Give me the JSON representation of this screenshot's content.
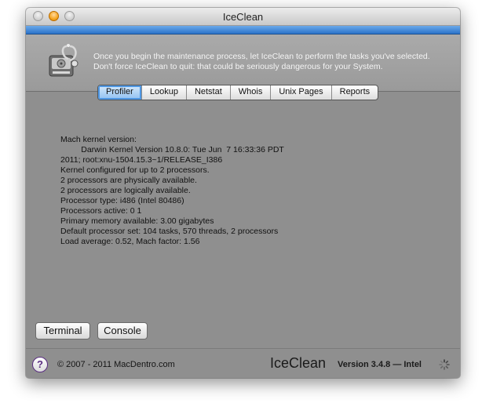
{
  "window": {
    "title": "IceClean"
  },
  "header": {
    "line1": "Once you begin the maintenance process, let IceClean to perform the tasks you've selected.",
    "line2": "Don't force IceClean to quit: that could be seriously dangerous for your System."
  },
  "tabs": [
    {
      "label": "Profiler",
      "active": true
    },
    {
      "label": "Lookup"
    },
    {
      "label": "Netstat"
    },
    {
      "label": "Whois"
    },
    {
      "label": "Unix Pages"
    },
    {
      "label": "Reports"
    }
  ],
  "content": {
    "lines": [
      "Mach kernel version:",
      "         Darwin Kernel Version 10.8.0: Tue Jun  7 16:33:36 PDT",
      "2011; root:xnu-1504.15.3~1/RELEASE_I386",
      "Kernel configured for up to 2 processors.",
      "2 processors are physically available.",
      "2 processors are logically available.",
      "Processor type: i486 (Intel 80486)",
      "Processors active: 0 1",
      "Primary memory available: 3.00 gigabytes",
      "Default processor set: 104 tasks, 570 threads, 2 processors",
      "Load average: 0.52, Mach factor: 1.56"
    ]
  },
  "buttons": {
    "terminal": "Terminal",
    "console": "Console"
  },
  "footer": {
    "help": "?",
    "copyright": "© 2007 - 2011 MacDentro.com",
    "app_name": "IceClean",
    "version": "Version 3.4.8 — Intel"
  },
  "icons": {
    "close": "close-button-icon",
    "minimize": "minimize-button-icon",
    "zoom": "zoom-button-icon",
    "app": "stethoscope-disk-icon",
    "spinner": "progress-spinner-icon"
  },
  "colors": {
    "accent": "#2b73c9",
    "background": "#8f8f8f"
  }
}
